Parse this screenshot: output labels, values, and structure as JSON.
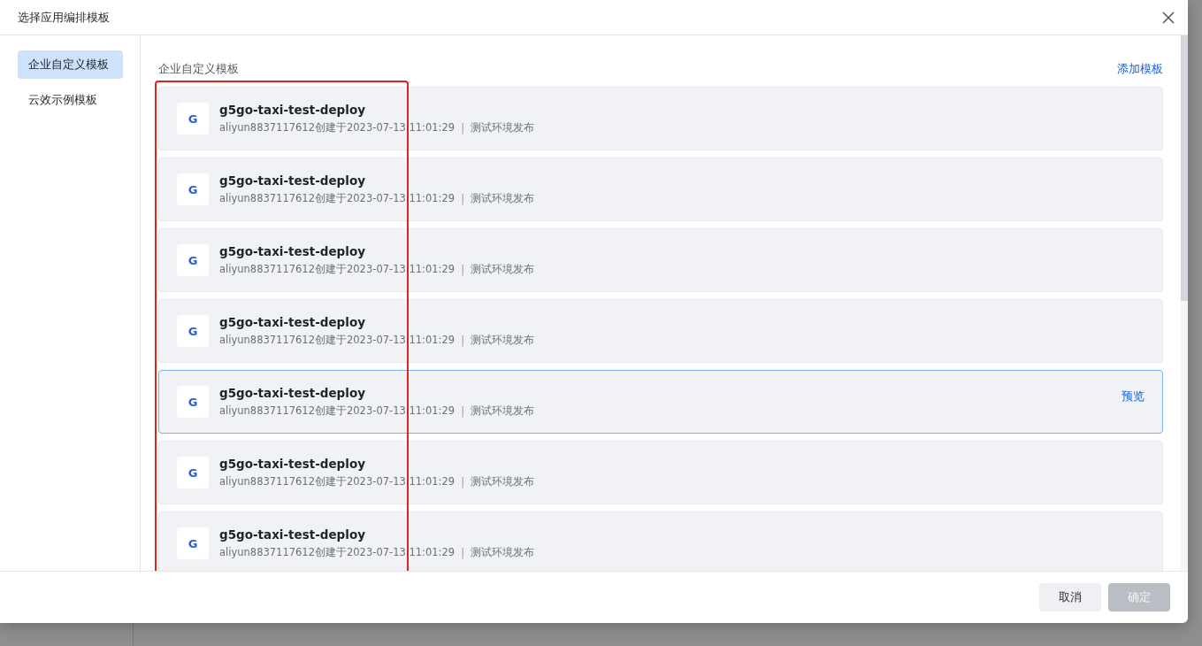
{
  "dialog": {
    "title": "选择应用编排模板"
  },
  "sidebar": {
    "items": [
      {
        "label": "企业自定义模板",
        "selected": true
      },
      {
        "label": "云效示例模板",
        "selected": false
      }
    ]
  },
  "section": {
    "title": "企业自定义模板",
    "action": "添加模板"
  },
  "templates": [
    {
      "icon_letter": "G",
      "name": "g5go-taxi-test-deploy",
      "meta": "aliyun8837117612创建于2023-07-13 11:01:29",
      "separator": "|",
      "tag": "测试环境发布",
      "selected": false
    },
    {
      "icon_letter": "G",
      "name": "g5go-taxi-test-deploy",
      "meta": "aliyun8837117612创建于2023-07-13 11:01:29",
      "separator": "|",
      "tag": "测试环境发布",
      "selected": false
    },
    {
      "icon_letter": "G",
      "name": "g5go-taxi-test-deploy",
      "meta": "aliyun8837117612创建于2023-07-13 11:01:29",
      "separator": "|",
      "tag": "测试环境发布",
      "selected": false
    },
    {
      "icon_letter": "G",
      "name": "g5go-taxi-test-deploy",
      "meta": "aliyun8837117612创建于2023-07-13 11:01:29",
      "separator": "|",
      "tag": "测试环境发布",
      "selected": false
    },
    {
      "icon_letter": "G",
      "name": "g5go-taxi-test-deploy",
      "meta": "aliyun8837117612创建于2023-07-13 11:01:29",
      "separator": "|",
      "tag": "测试环境发布",
      "selected": true,
      "action": "预览"
    },
    {
      "icon_letter": "G",
      "name": "g5go-taxi-test-deploy",
      "meta": "aliyun8837117612创建于2023-07-13 11:01:29",
      "separator": "|",
      "tag": "测试环境发布",
      "selected": false
    },
    {
      "icon_letter": "G",
      "name": "g5go-taxi-test-deploy",
      "meta": "aliyun8837117612创建于2023-07-13 11:01:29",
      "separator": "|",
      "tag": "测试环境发布",
      "selected": false
    }
  ],
  "footer": {
    "buttons": [
      {
        "label": "取消",
        "kind": "secondary",
        "disabled": false
      },
      {
        "label": "确定",
        "kind": "primary",
        "disabled": true
      }
    ]
  }
}
